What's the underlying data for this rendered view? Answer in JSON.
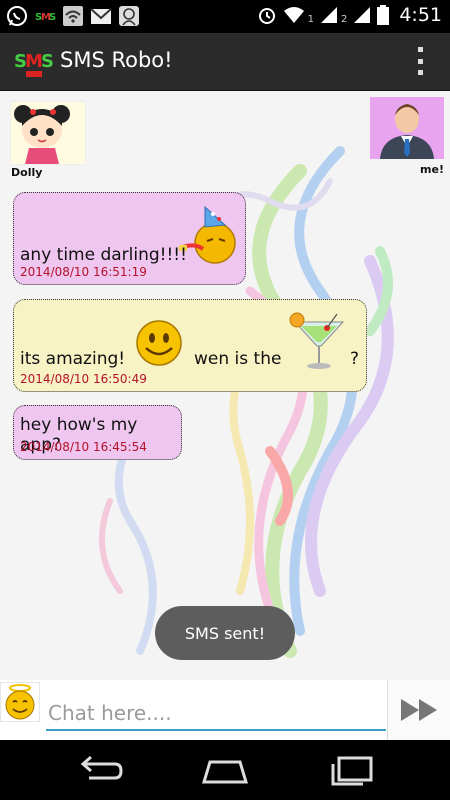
{
  "status_bar": {
    "time": "4:51",
    "sim1": "1",
    "sim2": "2",
    "left_icons": [
      "whatsapp-icon",
      "sms-robo-icon",
      "wifi-notification-icon",
      "gmail-icon",
      "bitmoji-icon"
    ],
    "right_icons": [
      "alarm-icon",
      "wifi-icon",
      "signal-icon",
      "battery-icon"
    ]
  },
  "app": {
    "title": "SMS Robo!",
    "logo_icon": "sms-robo-logo-icon",
    "menu_icon": "overflow-menu-icon"
  },
  "contact": {
    "name": "Dolly"
  },
  "me": {
    "name": "me!"
  },
  "messages": [
    {
      "text": "any time darling!!!!",
      "timestamp": "2014/08/10 16:51:19",
      "sender": "me",
      "emoticon": "party-emoji-icon",
      "color": "#eec6f0"
    },
    {
      "text_before": "its amazing!",
      "text_middle": "wen is the",
      "text_after": "?",
      "timestamp": "2014/08/10 16:50:49",
      "sender": "contact",
      "emoticons": [
        "smiley-emoji-icon",
        "cocktail-icon"
      ],
      "color": "#f7f3c4"
    },
    {
      "text": "hey how's my app?",
      "timestamp": "2014/08/10 16:45:54",
      "sender": "me",
      "color": "#eec6f0"
    }
  ],
  "toast": {
    "text": "SMS sent!"
  },
  "composer": {
    "placeholder": "Chat here....",
    "value": "",
    "emoji_icon": "angel-smiley-icon",
    "send_icon": "send-icon"
  },
  "nav": {
    "back": "back-icon",
    "home": "home-icon",
    "recents": "recents-icon"
  },
  "colors": {
    "accent": "#3aa0c9",
    "timestamp": "#b5122a",
    "action_bar": "#2b2b2b"
  }
}
